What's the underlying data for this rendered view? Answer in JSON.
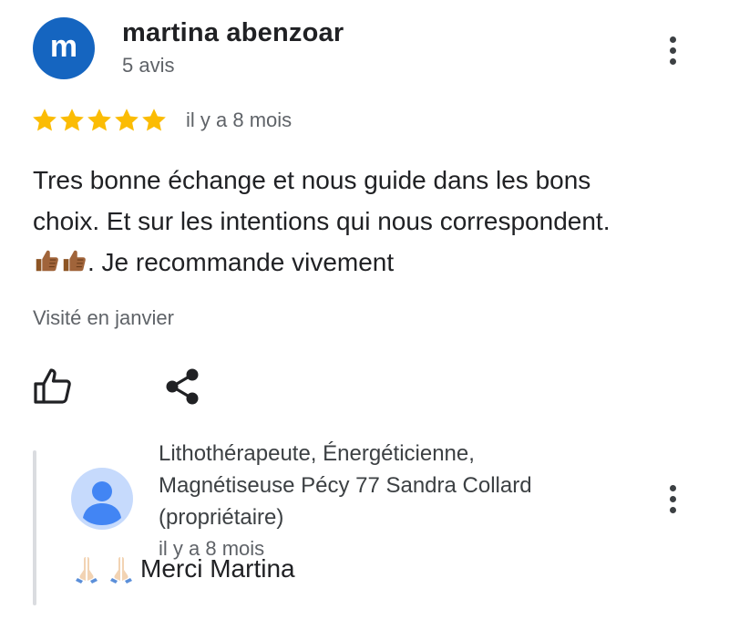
{
  "review": {
    "avatar_letter": "m",
    "avatar_color": "#1565c0",
    "reviewer_name": "martina abenzoar",
    "review_count": "5 avis",
    "rating": 5,
    "rating_max": 5,
    "star_color": "#fbbc04",
    "date": "il y a 8 mois",
    "text_line1": "Tres bonne échange et nous guide dans les bons",
    "text_line2": "choix. Et sur les intentions qui nous correspondent.",
    "text_line3": ". Je recommande vivement",
    "text_emojis": [
      "thumbs-up-icon",
      "thumbs-up-icon"
    ],
    "visit_info": "Visité en janvier",
    "actions": [
      "like-icon",
      "share-icon"
    ],
    "menu_icon": "more-vert-icon"
  },
  "reply": {
    "owner_avatar_icon": "person-icon",
    "owner_avatar_color": "#c6dafc",
    "owner_name_line1": "Lithothérapeute, Énergéticienne,",
    "owner_name_line2": "Magnétiseuse Pécy 77 Sandra Collard",
    "owner_name_line3": "(propriétaire)",
    "date": "il y a 8 mois",
    "text": "Merci Martina",
    "text_emojis": [
      "praying-hands-icon",
      "praying-hands-icon"
    ],
    "menu_icon": "more-vert-icon"
  }
}
